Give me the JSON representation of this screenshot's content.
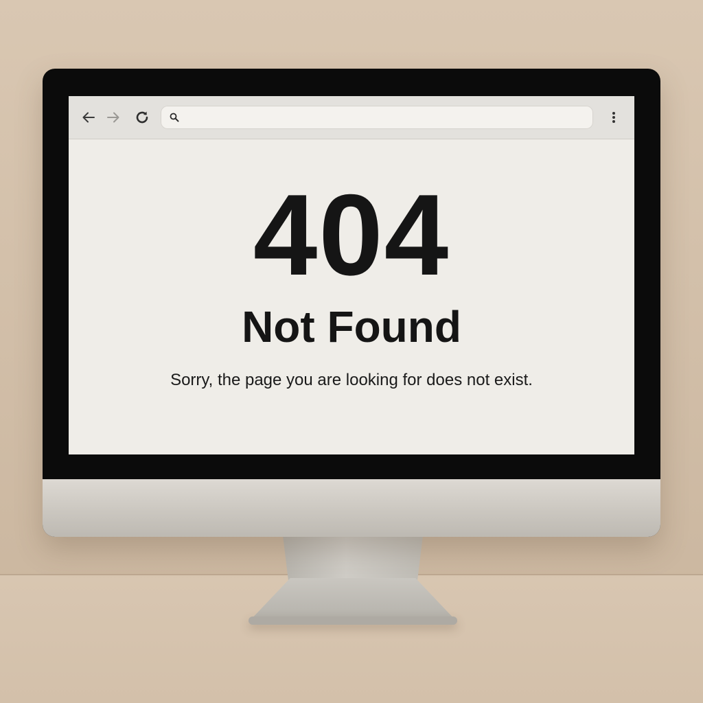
{
  "browser": {
    "back_icon": "arrow-left-icon",
    "forward_icon": "arrow-right-icon",
    "reload_icon": "reload-icon",
    "search_icon": "search-icon",
    "menu_icon": "kebab-menu-icon",
    "address": {
      "value": "",
      "placeholder": ""
    }
  },
  "page": {
    "code": "404",
    "title": "Not Found",
    "message": "Sorry, the page you are looking for does not exist."
  },
  "colors": {
    "wall": "#d9c7b2",
    "bezel": "#0b0b0b",
    "screen_bg": "#efede8",
    "text": "#151515"
  }
}
